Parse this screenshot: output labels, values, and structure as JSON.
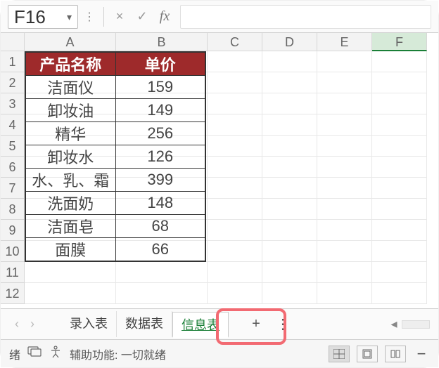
{
  "formula_bar": {
    "name_box": "F16",
    "cancel_glyph": "×",
    "accept_glyph": "✓",
    "fx_label": "fx",
    "formula_value": ""
  },
  "grid": {
    "columns": [
      "A",
      "B",
      "C",
      "D",
      "E",
      "F"
    ],
    "row_count": 12,
    "active_column": "F"
  },
  "table": {
    "headers": [
      "产品名称",
      "单价"
    ],
    "rows": [
      [
        "洁面仪",
        "159"
      ],
      [
        "卸妆油",
        "149"
      ],
      [
        "精华",
        "256"
      ],
      [
        "卸妆水",
        "126"
      ],
      [
        "水、乳、霜",
        "399"
      ],
      [
        "洗面奶",
        "148"
      ],
      [
        "洁面皂",
        "68"
      ],
      [
        "面膜",
        "66"
      ]
    ]
  },
  "sheets": {
    "tabs": [
      "录入表",
      "数据表",
      "信息表"
    ],
    "active_index": 2,
    "add_label": "+",
    "menu_glyph": "⋮"
  },
  "status": {
    "left_fragment": "绪",
    "accessibility_label": "辅助功能: 一切就绪",
    "views": [
      "normal",
      "page-layout",
      "page-break"
    ],
    "active_view": 0,
    "zoom_minus": "−"
  },
  "chart_data": {
    "type": "table",
    "title": "",
    "columns": [
      "产品名称",
      "单价"
    ],
    "rows": [
      {
        "产品名称": "洁面仪",
        "单价": 159
      },
      {
        "产品名称": "卸妆油",
        "单价": 149
      },
      {
        "产品名称": "精华",
        "单价": 256
      },
      {
        "产品名称": "卸妆水",
        "单价": 126
      },
      {
        "产品名称": "水、乳、霜",
        "单价": 399
      },
      {
        "产品名称": "洗面奶",
        "单价": 148
      },
      {
        "产品名称": "洁面皂",
        "单价": 68
      },
      {
        "产品名称": "面膜",
        "单价": 66
      }
    ]
  }
}
